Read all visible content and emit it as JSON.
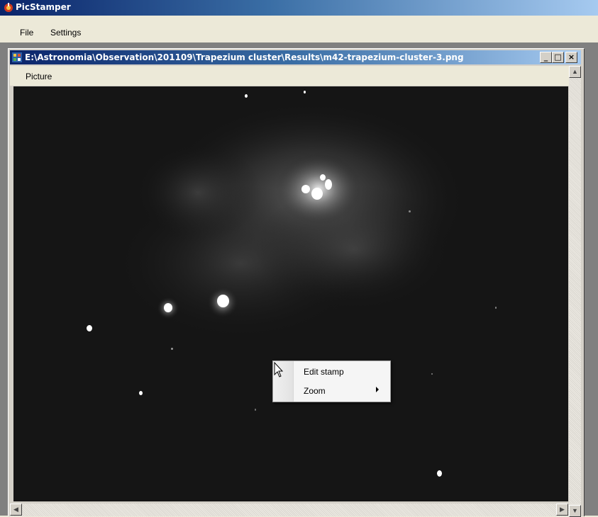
{
  "app": {
    "title": "PicStamper",
    "icon": "picstamper-app-icon"
  },
  "menubar": {
    "items": [
      "File",
      "Settings"
    ]
  },
  "child_window": {
    "title": "E:\\Astronomia\\Observation\\201109\\Trapezium cluster\\Results\\m42-trapezium-cluster-3.png",
    "icon": "document-icon",
    "controls": {
      "minimize": "_",
      "maximize": "□",
      "close": "×"
    },
    "menu": {
      "items": [
        "Picture"
      ]
    }
  },
  "context_menu": {
    "items": [
      {
        "label": "Edit stamp",
        "has_submenu": false
      },
      {
        "label": "Zoom",
        "has_submenu": true
      }
    ]
  },
  "colors": {
    "titlebar_start": "#0a246a",
    "titlebar_end": "#a6caf0",
    "picture_background": "#141414"
  }
}
